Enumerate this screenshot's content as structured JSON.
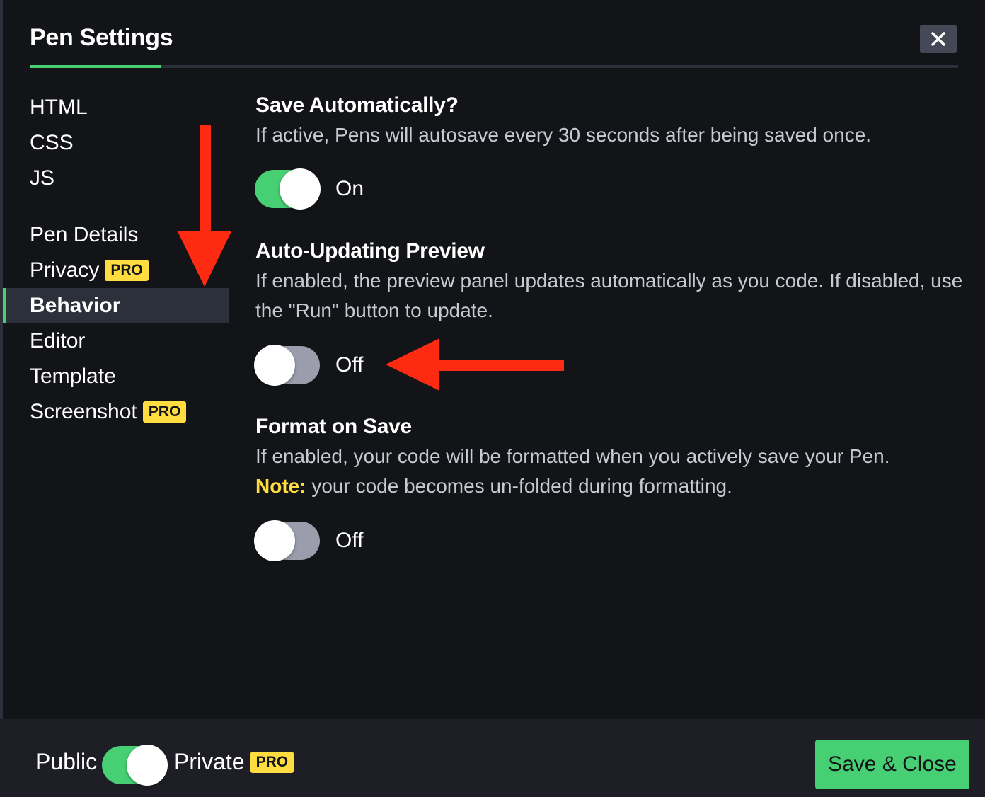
{
  "header": {
    "title": "Pen Settings",
    "close_icon": "close-icon"
  },
  "nav": {
    "group1": [
      {
        "label": "HTML"
      },
      {
        "label": "CSS"
      },
      {
        "label": "JS"
      }
    ],
    "group2": [
      {
        "label": "Pen Details",
        "pro": ""
      },
      {
        "label": "Privacy",
        "pro": "PRO"
      },
      {
        "label": "Behavior",
        "pro": "",
        "active": true
      },
      {
        "label": "Editor",
        "pro": ""
      },
      {
        "label": "Template",
        "pro": ""
      },
      {
        "label": "Screenshot",
        "pro": "PRO"
      }
    ]
  },
  "settings": [
    {
      "title": "Save Automatically?",
      "description": "If active, Pens will autosave every 30 seconds after being saved once.",
      "state": "on",
      "state_label": "On"
    },
    {
      "title": "Auto-Updating Preview",
      "description": "If enabled, the preview panel updates automatically as you code. If disabled, use the \"Run\" button to update.",
      "state": "off",
      "state_label": "Off"
    },
    {
      "title": "Format on Save",
      "description": "If enabled, your code will be formatted when you actively save your Pen.",
      "note_label": "Note:",
      "note_text": "your code becomes un-folded during formatting.",
      "state": "off",
      "state_label": "Off"
    }
  ],
  "footer": {
    "public_label": "Public",
    "private_label": "Private",
    "private_badge": "PRO",
    "visibility_toggle": "on",
    "save_close_label": "Save & Close"
  },
  "colors": {
    "background": "#131417",
    "accent_green": "#47cf73",
    "pro_yellow": "#ffdd40",
    "annotation_red": "#ff2a12"
  },
  "annotations": [
    "arrow-down-red",
    "arrow-left-red"
  ]
}
